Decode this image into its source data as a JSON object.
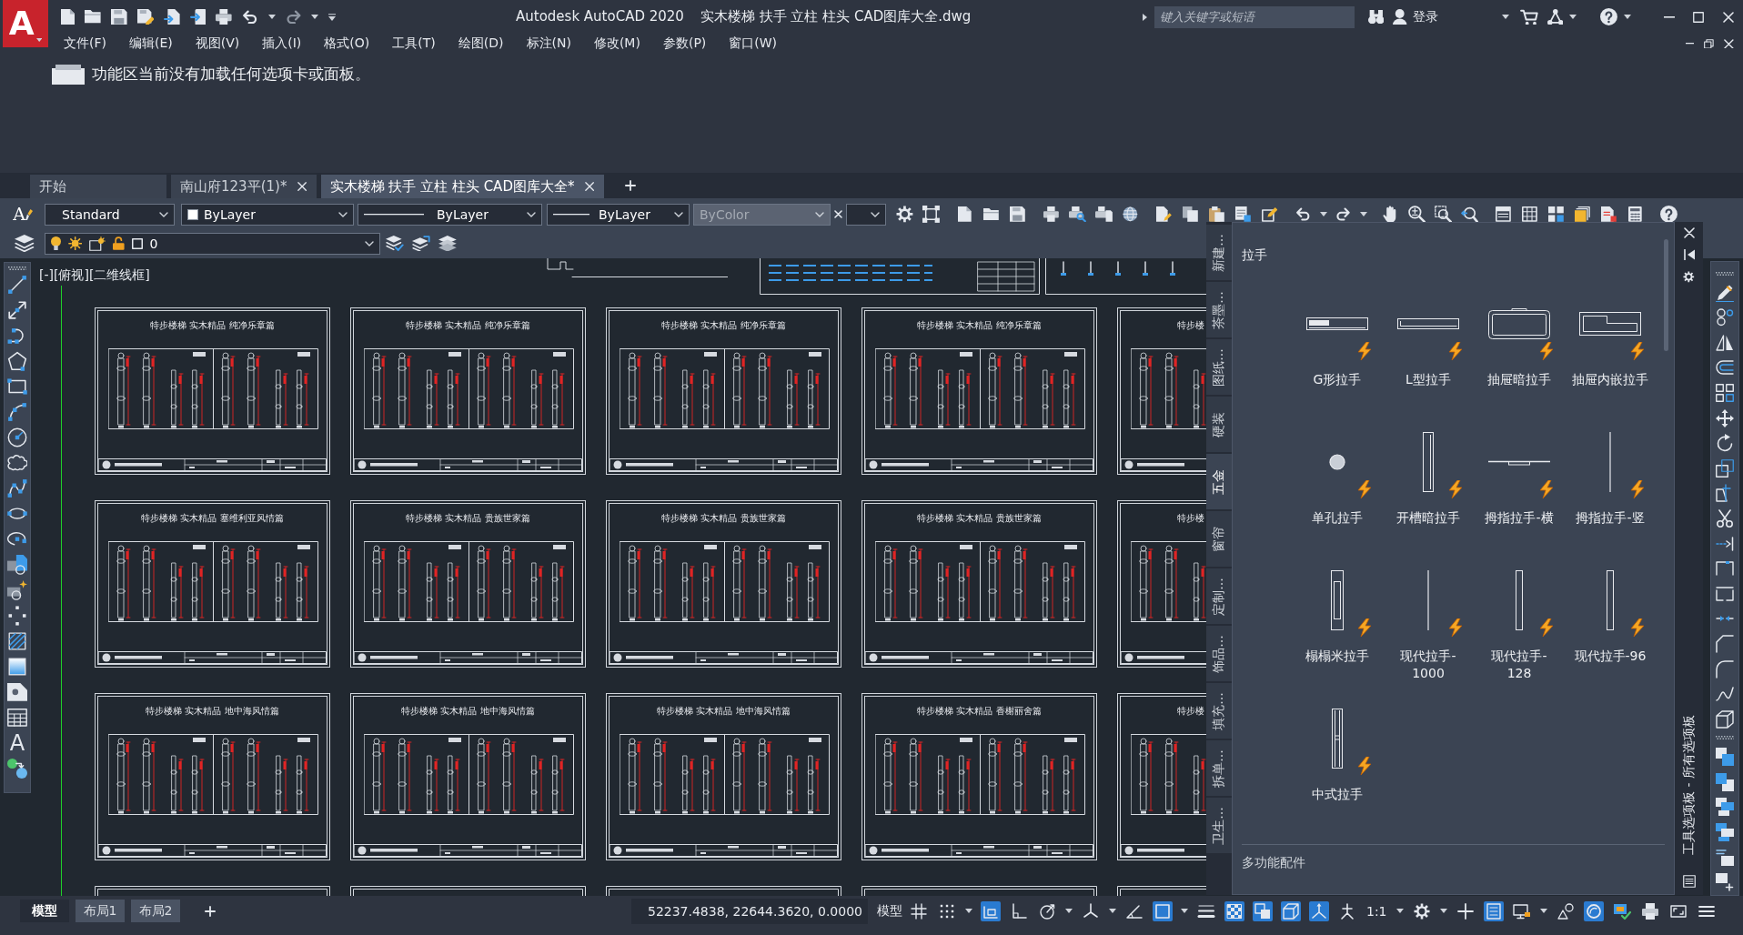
{
  "title_bar": {
    "logo": "A",
    "app_name": "Autodesk AutoCAD 2020",
    "file_name": "实木楼梯 扶手 立柱 柱头 CAD图库大全.dwg",
    "search": {
      "placeholder": "键入关键字或短语"
    },
    "sign_in": "登录"
  },
  "menu_bar": {
    "items": [
      "文件(F)",
      "编辑(E)",
      "视图(V)",
      "插入(I)",
      "格式(O)",
      "工具(T)",
      "绘图(D)",
      "标注(N)",
      "修改(M)",
      "参数(P)",
      "窗口(W)"
    ]
  },
  "ribbon": {
    "message": "功能区当前没有加载任何选项卡或面板。"
  },
  "file_tabs": [
    {
      "label": "开始",
      "selected": false,
      "closable": false
    },
    {
      "label": "南山府123平(1)*",
      "selected": false,
      "closable": true
    },
    {
      "label": "实木楼梯 扶手 立柱 柱头 CAD图库大全*",
      "selected": true,
      "closable": true
    }
  ],
  "toolbars": {
    "text_style_glyph": "A",
    "text_style": "Standard",
    "color_control": "ByLayer",
    "linetype": "ByLayer",
    "lineweight": "ByLayer",
    "plot_style": {
      "value": "ByColor",
      "disabled": true
    },
    "layer": "0"
  },
  "draw_toolbar": {
    "text_glyph": "A"
  },
  "viewport": {
    "label": "[-][俯视][二维线框]",
    "sheets": [
      {
        "kind": "full",
        "title": "特步楼梯 实木精品 纯净乐章篇"
      },
      {
        "kind": "full",
        "title": "特步楼梯 实木精品 纯净乐章篇"
      },
      {
        "kind": "full",
        "title": "特步楼梯 实木精品 纯净乐章篇"
      },
      {
        "kind": "full",
        "title": "特步楼梯 实木精品 纯净乐章篇"
      },
      {
        "kind": "cut",
        "title": "特步楼"
      },
      {
        "kind": "full",
        "title": "特步楼梯 实木精品 塞维利亚风情篇"
      },
      {
        "kind": "full",
        "title": "特步楼梯 实木精品 贵族世家篇"
      },
      {
        "kind": "full",
        "title": "特步楼梯 实木精品 贵族世家篇"
      },
      {
        "kind": "full",
        "title": "特步楼梯 实木精品 贵族世家篇"
      },
      {
        "kind": "cut",
        "title": "特步楼"
      },
      {
        "kind": "full",
        "title": "特步楼梯 实木精品 地中海风情篇"
      },
      {
        "kind": "full",
        "title": "特步楼梯 实木精品 地中海风情篇"
      },
      {
        "kind": "full",
        "title": "特步楼梯 实木精品 地中海风情篇"
      },
      {
        "kind": "full",
        "title": "特步楼梯 实木精品 香榭丽舍篇"
      },
      {
        "kind": "cut",
        "title": "特步楼"
      }
    ]
  },
  "tool_palette": {
    "tabs": [
      {
        "label": "新建...",
        "selected": false
      },
      {
        "label": "茶墨...",
        "selected": false
      },
      {
        "label": "图纸...",
        "selected": false
      },
      {
        "label": "硬装",
        "selected": false
      },
      {
        "label": "五金",
        "selected": true
      },
      {
        "label": "窗帘",
        "selected": false
      },
      {
        "label": "定制...",
        "selected": false
      },
      {
        "label": "饰品...",
        "selected": false
      },
      {
        "label": "填充...",
        "selected": false
      },
      {
        "label": "拆单...",
        "selected": false
      },
      {
        "label": "卫生...",
        "selected": false
      }
    ],
    "section": "拉手",
    "tools": [
      {
        "label": "G形拉手",
        "kind": "gprofile"
      },
      {
        "label": "L型拉手",
        "kind": "lprofile"
      },
      {
        "label": "抽屉暗拉手",
        "kind": "frame"
      },
      {
        "label": "抽屉内嵌拉手",
        "kind": "notched"
      },
      {
        "label": "单孔拉手",
        "kind": "knob"
      },
      {
        "label": "开槽暗拉手",
        "kind": "slot"
      },
      {
        "label": "拇指拉手-横",
        "kind": "flat"
      },
      {
        "label": "拇指拉手-竖",
        "kind": "line"
      },
      {
        "label": "榻榻米拉手",
        "kind": "inset"
      },
      {
        "label": "现代拉手-1000",
        "kind": "line"
      },
      {
        "label": "现代拉手-128",
        "kind": "bar"
      },
      {
        "label": "现代拉手-96",
        "kind": "bar"
      },
      {
        "label": "中式拉手",
        "kind": "ornate"
      }
    ],
    "next_section": "多功能配件",
    "title": "工具选项板 - 所有选项板"
  },
  "layout_tabs": [
    {
      "label": "模型",
      "selected": true
    },
    {
      "label": "布局1",
      "selected": false
    },
    {
      "label": "布局2",
      "selected": false
    }
  ],
  "status_bar": {
    "coordinates": "52237.4838, 22644.3620, 0.0000",
    "space": "模型",
    "scale": "1:1",
    "toggles": [
      {
        "on": false
      },
      {
        "on": false
      },
      {
        "on": true
      },
      {
        "on": false
      },
      {
        "on": false
      },
      {
        "on": false
      },
      {
        "on": false
      },
      {
        "on": true
      },
      {
        "on": false
      },
      {
        "on": true
      },
      {
        "on": true
      },
      {
        "on": true
      },
      {
        "on": true
      },
      {
        "on": true
      },
      {
        "on": true
      }
    ]
  }
}
